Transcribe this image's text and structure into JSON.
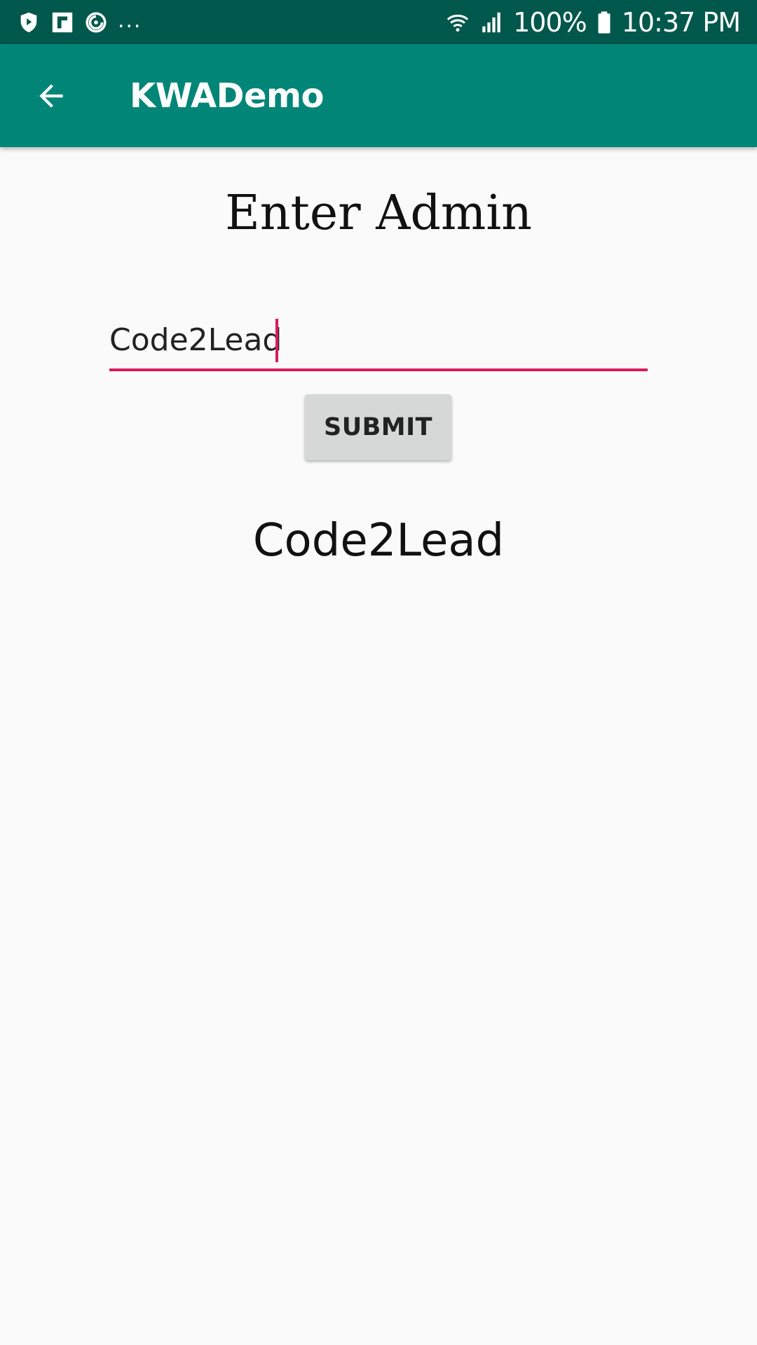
{
  "status_bar": {
    "icons_left": [
      "shield-play-icon",
      "flipboard-icon",
      "sync-circle-icon"
    ],
    "more_indicator": "...",
    "icons_right": [
      "wifi-icon",
      "signal-icon",
      "battery-icon"
    ],
    "battery": "100%",
    "time": "10:37 PM"
  },
  "app_bar": {
    "back_icon": "arrow-back-icon",
    "title": "KWADemo"
  },
  "form": {
    "heading": "Enter Admin",
    "input_value": "Code2Lead",
    "submit_label": "SUBMIT",
    "result": "Code2Lead"
  },
  "colors": {
    "status_bar": "#00574b",
    "app_bar": "#008577",
    "accent": "#d81b60",
    "background": "#fafafa",
    "button": "#d6d7d7"
  }
}
